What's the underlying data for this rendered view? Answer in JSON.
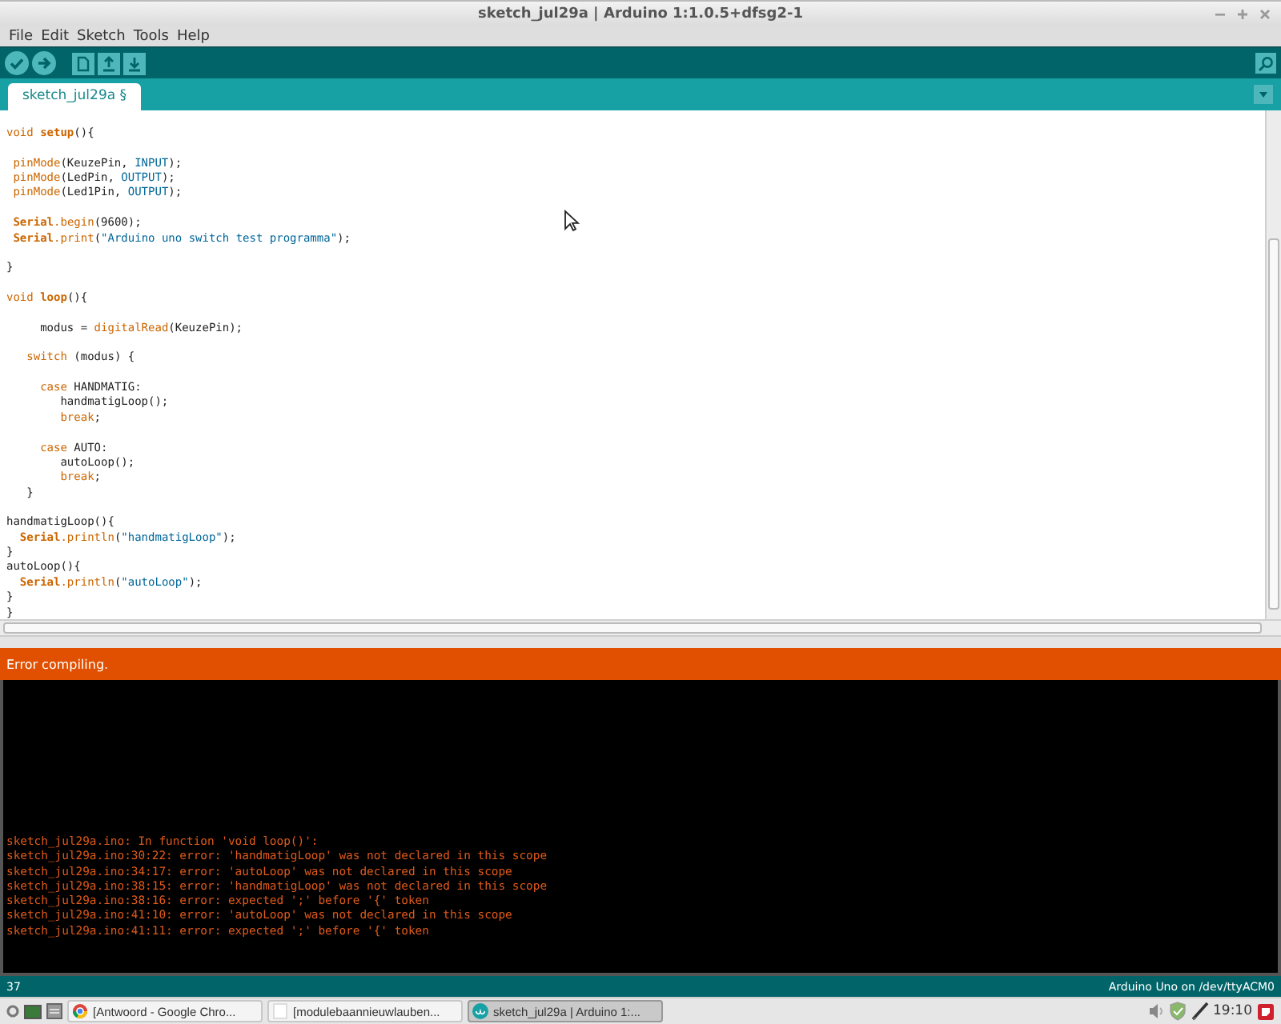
{
  "window": {
    "title": "sketch_jul29a | Arduino 1:1.0.5+dfsg2-1"
  },
  "menu": [
    "File",
    "Edit",
    "Sketch",
    "Tools",
    "Help"
  ],
  "toolbar": [
    {
      "kind": "verify"
    },
    {
      "kind": "upload"
    },
    {
      "kind": "new"
    },
    {
      "kind": "open"
    },
    {
      "kind": "save"
    }
  ],
  "tabs": [
    {
      "label": "sketch_jul29a §",
      "selected": true
    }
  ],
  "editor": {
    "lines": [
      {
        "kind": "code",
        "segments": [
          {
            "text": "void ",
            "kind": "keyword"
          },
          {
            "text": "setup",
            "kind": "function-bold"
          },
          {
            "text": "(){",
            "kind": "plain"
          }
        ]
      },
      {
        "kind": "blank"
      },
      {
        "kind": "code",
        "segments": [
          {
            "text": " pinMode",
            "kind": "function"
          },
          {
            "text": "(KeuzePin, ",
            "kind": "plain"
          },
          {
            "text": "INPUT",
            "kind": "constant"
          },
          {
            "text": ");",
            "kind": "plain"
          }
        ]
      },
      {
        "kind": "code",
        "segments": [
          {
            "text": " pinMode",
            "kind": "function"
          },
          {
            "text": "(LedPin, ",
            "kind": "plain"
          },
          {
            "text": "OUTPUT",
            "kind": "constant"
          },
          {
            "text": ");",
            "kind": "plain"
          }
        ]
      },
      {
        "kind": "code",
        "segments": [
          {
            "text": " pinMode",
            "kind": "function"
          },
          {
            "text": "(Led1Pin, ",
            "kind": "plain"
          },
          {
            "text": "OUTPUT",
            "kind": "constant"
          },
          {
            "text": ");",
            "kind": "plain"
          }
        ]
      },
      {
        "kind": "blank"
      },
      {
        "kind": "code",
        "segments": [
          {
            "text": " Serial",
            "kind": "function-bold"
          },
          {
            "text": ".begin",
            "kind": "function"
          },
          {
            "text": "(9600);",
            "kind": "plain"
          }
        ]
      },
      {
        "kind": "code",
        "segments": [
          {
            "text": " Serial",
            "kind": "function-bold"
          },
          {
            "text": ".print",
            "kind": "function"
          },
          {
            "text": "(",
            "kind": "plain"
          },
          {
            "text": "\"Arduino uno switch test programma\"",
            "kind": "string"
          },
          {
            "text": ");",
            "kind": "plain"
          }
        ]
      },
      {
        "kind": "blank"
      },
      {
        "kind": "code",
        "segments": [
          {
            "text": "}",
            "kind": "plain"
          }
        ]
      },
      {
        "kind": "blank"
      },
      {
        "kind": "code",
        "segments": [
          {
            "text": "void ",
            "kind": "keyword"
          },
          {
            "text": "loop",
            "kind": "function-bold"
          },
          {
            "text": "(){",
            "kind": "plain"
          }
        ]
      },
      {
        "kind": "blank"
      },
      {
        "kind": "code",
        "segments": [
          {
            "text": "     modus = ",
            "kind": "plain"
          },
          {
            "text": "digitalRead",
            "kind": "function"
          },
          {
            "text": "(KeuzePin);",
            "kind": "plain"
          }
        ]
      },
      {
        "kind": "blank"
      },
      {
        "kind": "code",
        "segments": [
          {
            "text": "   switch",
            "kind": "keyword"
          },
          {
            "text": " (modus) {",
            "kind": "plain"
          }
        ]
      },
      {
        "kind": "blank"
      },
      {
        "kind": "code",
        "segments": [
          {
            "text": "     case",
            "kind": "keyword"
          },
          {
            "text": " HANDMATIG:",
            "kind": "plain"
          }
        ]
      },
      {
        "kind": "code",
        "segments": [
          {
            "text": "        handmatigLoop();",
            "kind": "plain"
          }
        ]
      },
      {
        "kind": "code",
        "segments": [
          {
            "text": "        break",
            "kind": "keyword"
          },
          {
            "text": ";",
            "kind": "plain"
          }
        ]
      },
      {
        "kind": "blank"
      },
      {
        "kind": "code",
        "segments": [
          {
            "text": "     case",
            "kind": "keyword"
          },
          {
            "text": " AUTO:",
            "kind": "plain"
          }
        ]
      },
      {
        "kind": "code",
        "segments": [
          {
            "text": "        autoLoop();",
            "kind": "plain"
          }
        ]
      },
      {
        "kind": "code",
        "segments": [
          {
            "text": "        break",
            "kind": "keyword"
          },
          {
            "text": ";",
            "kind": "plain"
          }
        ]
      },
      {
        "kind": "code",
        "segments": [
          {
            "text": "   }",
            "kind": "plain"
          }
        ]
      },
      {
        "kind": "blank"
      },
      {
        "kind": "code",
        "segments": [
          {
            "text": "handmatigLoop(){",
            "kind": "plain"
          }
        ]
      },
      {
        "kind": "code",
        "segments": [
          {
            "text": "  Serial",
            "kind": "function-bold"
          },
          {
            "text": ".println",
            "kind": "function"
          },
          {
            "text": "(",
            "kind": "plain"
          },
          {
            "text": "\"handmatigLoop\"",
            "kind": "string"
          },
          {
            "text": ");",
            "kind": "plain"
          }
        ]
      },
      {
        "kind": "code",
        "segments": [
          {
            "text": "}",
            "kind": "plain"
          }
        ]
      },
      {
        "kind": "code",
        "segments": [
          {
            "text": "autoLoop(){",
            "kind": "plain"
          }
        ]
      },
      {
        "kind": "code",
        "segments": [
          {
            "text": "  Serial",
            "kind": "function-bold"
          },
          {
            "text": ".println",
            "kind": "function"
          },
          {
            "text": "(",
            "kind": "plain"
          },
          {
            "text": "\"autoLoop\"",
            "kind": "string"
          },
          {
            "text": ");",
            "kind": "plain"
          }
        ]
      },
      {
        "kind": "code",
        "segments": [
          {
            "text": "}",
            "kind": "plain"
          }
        ]
      },
      {
        "kind": "code",
        "segments": [
          {
            "text": "}",
            "kind": "plain"
          }
        ]
      }
    ]
  },
  "status": {
    "message": "Error compiling."
  },
  "console": {
    "lines": [
      "sketch_jul29a.ino: In function 'void loop()':",
      "sketch_jul29a.ino:30:22: error: 'handmatigLoop' was not declared in this scope",
      "sketch_jul29a.ino:34:17: error: 'autoLoop' was not declared in this scope",
      "sketch_jul29a.ino:38:15: error: 'handmatigLoop' was not declared in this scope",
      "sketch_jul29a.ino:38:16: error: expected ';' before '{' token",
      "sketch_jul29a.ino:41:10: error: 'autoLoop' was not declared in this scope",
      "sketch_jul29a.ino:41:11: error: expected ';' before '{' token"
    ]
  },
  "status_bar": {
    "line": "37",
    "board": "Arduino Uno on /dev/ttyACM0"
  },
  "taskbar": {
    "windows": [
      {
        "label": "[Antwoord - Google Chro...",
        "kind": "browser",
        "selected": false
      },
      {
        "label": "[modulebaannieuwlauben...",
        "kind": "document",
        "selected": false
      },
      {
        "label": "sketch_jul29a | Arduino 1:...",
        "kind": "arduino",
        "selected": true
      }
    ],
    "clock": "19:10"
  }
}
